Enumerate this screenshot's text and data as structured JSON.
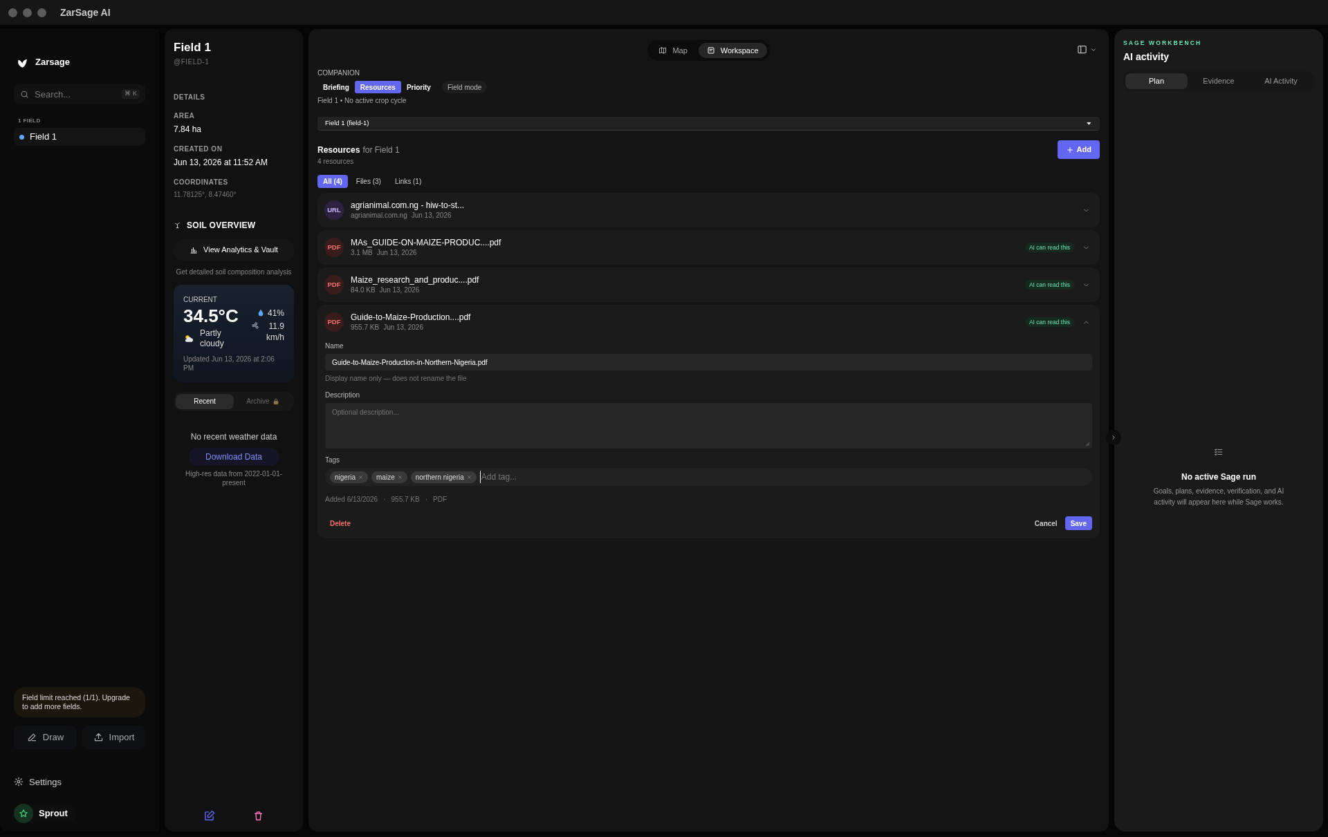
{
  "window": {
    "title": "ZarSage AI"
  },
  "sidebar": {
    "brand": "Zarsage",
    "search": {
      "placeholder": "Search...",
      "shortcut": "⌘ K"
    },
    "section_label": "1 FIELD",
    "fields": [
      {
        "label": "Field 1",
        "selected": true,
        "color": "#60a5fa"
      }
    ],
    "notice": "Field limit reached (1/1). Upgrade to add more fields.",
    "actions": [
      {
        "label": "Draw",
        "kind": "draw"
      },
      {
        "label": "Import",
        "kind": "import"
      }
    ],
    "settings": "Settings",
    "user": {
      "name": "Sprout"
    }
  },
  "field_panel": {
    "title": "Field 1",
    "handle": "@FIELD-1",
    "details_heading": "DETAILS",
    "details": [
      {
        "label": "AREA",
        "value": "7.84 ha",
        "kind": "plain"
      },
      {
        "label": "CREATED ON",
        "value": "Jun 13, 2026 at 11:52 AM",
        "kind": "plain"
      },
      {
        "label": "COORDINATES",
        "value": "11.78125°, 8.47460°",
        "kind": "muted"
      }
    ],
    "soil": {
      "heading": "SOIL OVERVIEW",
      "button": "View Analytics & Vault",
      "caption": "Get detailed soil composition analysis"
    },
    "weather": {
      "label": "CURRENT",
      "temperature": "34.5°C",
      "condition": "Partly cloudy",
      "humidity": "41%",
      "wind": "11.9 km/h",
      "updated": "Updated Jun 13, 2026 at 2:06 PM"
    },
    "weather_tabs": [
      {
        "label": "Recent",
        "selected": true,
        "locked": false
      },
      {
        "label": "Archive",
        "selected": false,
        "locked": true
      }
    ],
    "empty_message": "No recent weather data",
    "download_button": "Download Data",
    "data_note": "High-res data from 2022-01-01-present"
  },
  "view_switch": [
    {
      "label": "Map",
      "kind": "map",
      "selected": false
    },
    {
      "label": "Workspace",
      "kind": "workspace",
      "selected": true
    }
  ],
  "companion": {
    "label": "COMPANION",
    "tabs": [
      {
        "label": "Briefing",
        "selected": false
      },
      {
        "label": "Resources",
        "selected": true
      },
      {
        "label": "Priority",
        "selected": false
      }
    ],
    "mode_button": "Field mode",
    "subtitle": "Field 1 • No active crop cycle",
    "field_select": "Field 1 (field-1)"
  },
  "resources": {
    "title": "Resources",
    "title_suffix": "for Field 1",
    "count": "4 resources",
    "add_button": "Add",
    "filters": [
      {
        "label": "All (4)",
        "selected": true
      },
      {
        "label": "Files (3)",
        "selected": false
      },
      {
        "label": "Links (1)",
        "selected": false
      }
    ],
    "items": [
      {
        "kind": "link",
        "badge": "URL",
        "name": "agrianimal.com.ng - hiw-to-st...",
        "meta": [
          "agrianimal.com.ng",
          "Jun 13, 2026"
        ],
        "expanded": false
      },
      {
        "kind": "file",
        "badge": "PDF",
        "name": "MAs_GUIDE-ON-MAIZE-PRODUC....pdf",
        "meta": [
          "3.1 MB",
          "Jun 13, 2026"
        ],
        "ai_label": "AI can read this",
        "expanded": false
      },
      {
        "kind": "file",
        "badge": "PDF",
        "name": "Maize_research_and_produc....pdf",
        "meta": [
          "84.0 KB",
          "Jun 13, 2026"
        ],
        "ai_label": "AI can read this",
        "expanded": false
      },
      {
        "kind": "file",
        "badge": "PDF",
        "name": "Guide-to-Maize-Production....pdf",
        "meta": [
          "955.7 KB",
          "Jun 13, 2026"
        ],
        "ai_label": "AI can read this",
        "expanded": true,
        "editor": {
          "name_label": "Name",
          "name_value": "Guide-to-Maize-Production-in-Northern-Nigeria.pdf",
          "name_hint": "Display name only — does not rename the file",
          "description_label": "Description",
          "description_placeholder": "Optional description...",
          "tags_label": "Tags",
          "tags": [
            "nigeria",
            "maize",
            "northern nigeria"
          ],
          "tag_placeholder": "Add tag...",
          "info": [
            "Added 6/13/2026",
            "·",
            "955.7 KB",
            "·",
            "PDF"
          ],
          "delete_button": "Delete",
          "cancel_button": "Cancel",
          "save_button": "Save"
        }
      }
    ]
  },
  "workbench": {
    "eyebrow": "SAGE WORKBENCH",
    "title": "AI activity",
    "tabs": [
      {
        "label": "Plan",
        "selected": true
      },
      {
        "label": "Evidence",
        "selected": false
      },
      {
        "label": "AI Activity",
        "selected": false
      }
    ],
    "empty_title": "No active Sage run",
    "empty_text": "Goals, plans, evidence, verification, and AI activity will appear here while Sage works."
  }
}
